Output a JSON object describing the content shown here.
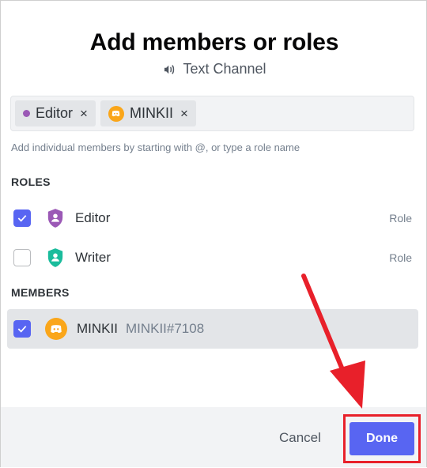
{
  "dialog": {
    "title": "Add members or roles",
    "subtitle": "Text Channel"
  },
  "picker": {
    "chips": [
      {
        "label": "Editor",
        "remove": "×"
      },
      {
        "label": "MINKII",
        "remove": "×"
      }
    ]
  },
  "hint": "Add individual members by starting with @, or type a role name",
  "roles": {
    "heading": "ROLES",
    "items": [
      {
        "name": "Editor",
        "tag": "Role",
        "checked": true,
        "color": "#9b59b6"
      },
      {
        "name": "Writer",
        "tag": "Role",
        "checked": false,
        "color": "#1abc9c"
      }
    ]
  },
  "members": {
    "heading": "MEMBERS",
    "items": [
      {
        "name": "MINKII",
        "tag": "MINKII#7108",
        "checked": true
      }
    ]
  },
  "footer": {
    "cancel_label": "Cancel",
    "done_label": "Done"
  },
  "colors": {
    "accent": "#5865f2",
    "annotation": "#e8202a",
    "avatar": "#faa61a"
  }
}
